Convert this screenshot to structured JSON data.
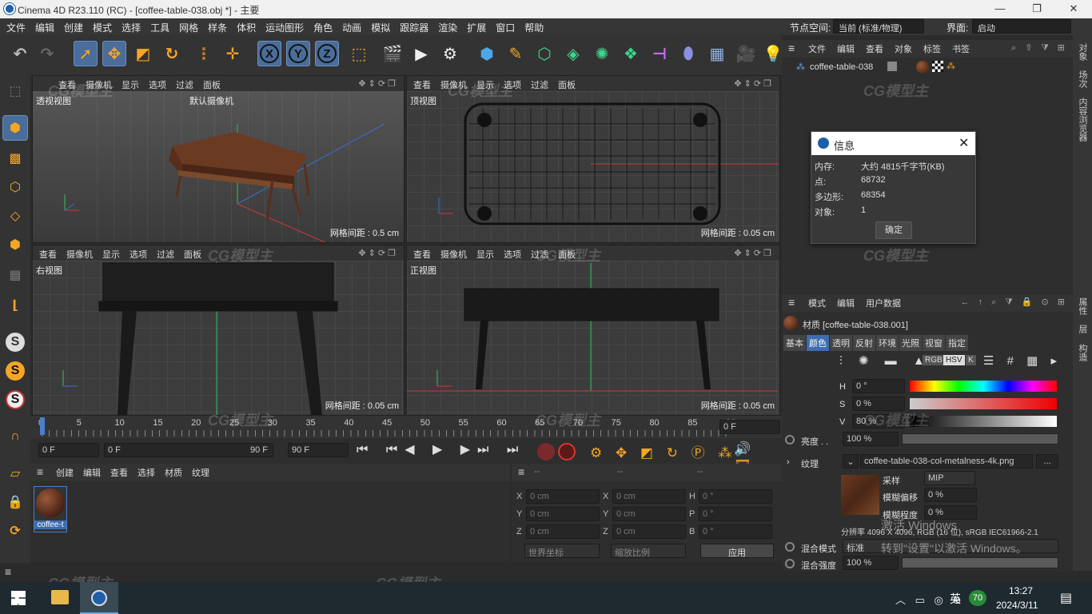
{
  "window": {
    "title": "Cinema 4D R23.110 (RC) - [coffee-table-038.obj *] - 主要",
    "min": "—",
    "max": "❐",
    "close": "✕"
  },
  "menu": {
    "items": [
      "文件",
      "编辑",
      "创建",
      "模式",
      "选择",
      "工具",
      "网格",
      "样条",
      "体积",
      "运动图形",
      "角色",
      "动画",
      "模拟",
      "跟踪器",
      "渲染",
      "扩展",
      "窗口",
      "帮助"
    ],
    "node_space_label": "节点空间:",
    "node_space_value": "当前 (标准/物理)",
    "interface_label": "界面:",
    "interface_value": "启动"
  },
  "viewport_menu": [
    "查看",
    "摄像机",
    "显示",
    "选项",
    "过滤",
    "面板"
  ],
  "viewports": {
    "persp": {
      "label": "透视视图",
      "camera": "默认摄像机",
      "grid": "网格间距 : 0.5 cm"
    },
    "top": {
      "label": "顶视图",
      "grid": "网格间距 : 0.05 cm"
    },
    "right": {
      "label": "右视图",
      "grid": "网格间距 : 0.05 cm"
    },
    "front": {
      "label": "正视图",
      "grid": "网格间距 : 0.05 cm"
    }
  },
  "timeline": {
    "ticks": [
      "0",
      "5",
      "10",
      "15",
      "20",
      "25",
      "30",
      "35",
      "40",
      "45",
      "50",
      "55",
      "60",
      "65",
      "70",
      "75",
      "80",
      "85",
      "90"
    ],
    "end": "0 F"
  },
  "transport": {
    "start": "0 F",
    "cur": "0 F",
    "range_end": "90 F",
    "end": "90 F"
  },
  "matmgr": {
    "menu": [
      "创建",
      "编辑",
      "查看",
      "选择",
      "材质",
      "纹理"
    ],
    "mat_name": "coffee-t"
  },
  "coords": {
    "hdr": [
      "--",
      "--",
      "--"
    ],
    "rows": [
      {
        "a": "X",
        "av": "0 cm",
        "b": "X",
        "bv": "0 cm",
        "c": "H",
        "cv": "0 °"
      },
      {
        "a": "Y",
        "av": "0 cm",
        "b": "Y",
        "bv": "0 cm",
        "c": "P",
        "cv": "0 °"
      },
      {
        "a": "Z",
        "av": "0 cm",
        "b": "Z",
        "bv": "0 cm",
        "c": "B",
        "cv": "0 °"
      }
    ],
    "world": "世界坐标",
    "scale": "缩放比例",
    "apply": "应用"
  },
  "objmgr": {
    "menu": [
      "文件",
      "编辑",
      "查看",
      "对象",
      "标签",
      "书签"
    ],
    "object": "coffee-table-038"
  },
  "dialog": {
    "title": "信息",
    "rows": [
      {
        "k": "内存:",
        "v": "大约 4815千字节(KB)"
      },
      {
        "k": "点:",
        "v": "68732"
      },
      {
        "k": "多边形:",
        "v": "68354"
      },
      {
        "k": "对象:",
        "v": "1"
      }
    ],
    "ok": "确定"
  },
  "attr": {
    "menu": [
      "模式",
      "编辑",
      "用户数据"
    ],
    "material": "材质 [coffee-table-038.001]",
    "tabs": [
      "基本",
      "颜色",
      "透明",
      "反射",
      "环境",
      "光照",
      "视窗",
      "指定"
    ],
    "active_tab": "颜色",
    "modes": [
      "RGB",
      "HSV",
      "K"
    ],
    "h_label": "H",
    "h_val": "0 °",
    "s_label": "S",
    "s_val": "0 %",
    "v_label": "V",
    "v_val": "80 %",
    "brightness_label": "亮度 . .",
    "brightness_val": "100 %",
    "brightness_fill": 1.0,
    "texture_label": "纹理",
    "texture_file": "coffee-table-038-col-metalness-4k.png",
    "texture_more": "...",
    "sample_label": "采样",
    "sample_val": "MIP",
    "blur_off_label": "模糊偏移",
    "blur_off_val": "0 %",
    "blur_deg_label": "模糊程度",
    "blur_deg_val": "0 %",
    "resolution": "分辨率 4096 X 4096, RGB (16 位), sRGB IEC61966-2.1",
    "blend_mode_label": "混合模式",
    "blend_mode_val": "标准",
    "blend_str_label": "混合强度",
    "blend_str_val": "100 %",
    "blend_str_fill": 1.0,
    "activate": "激活 Windows",
    "activate2": "转到\"设置\"以激活 Windows。"
  },
  "side_tabs": [
    "对象",
    "场次",
    "内容浏览器",
    "属性",
    "层",
    "构造"
  ],
  "taskbar": {
    "time": "13:27",
    "date": "2024/3/11",
    "lang": "英",
    "badge": "70"
  },
  "watermark": "CG模型主"
}
